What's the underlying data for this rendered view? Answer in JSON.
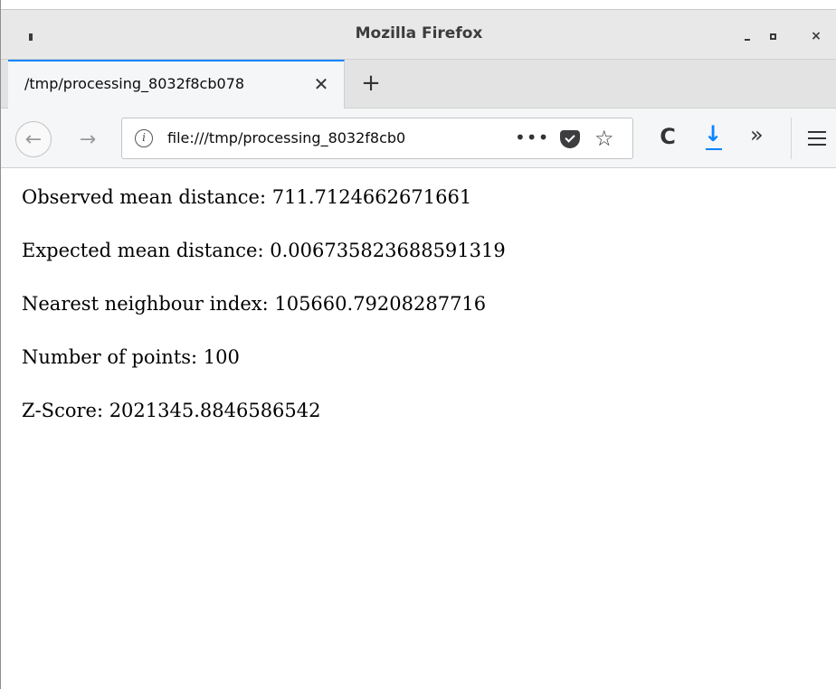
{
  "window": {
    "title": "Mozilla Firefox",
    "menu_icon": "window-menu-icon",
    "controls": {
      "minimize": "minimize-icon",
      "maximize": "maximize-icon",
      "close": "×"
    }
  },
  "tabs": [
    {
      "title": "/tmp/processing_8032f8cb078",
      "close": "✕",
      "active": true
    }
  ],
  "newtab_label": "+",
  "nav": {
    "back": "←",
    "forward": "→",
    "url": "file:///tmp/processing_8032f8cb0",
    "info": "i",
    "page_actions": "•••",
    "star": "☆",
    "reload": "C",
    "download": "↓",
    "overflow": "»"
  },
  "content": {
    "lines": [
      "Observed mean distance: 711.7124662671661",
      "Expected mean distance: 0.006735823688591319",
      "Nearest neighbour index: 105660.79208287716",
      "Number of points: 100",
      "Z-Score: 2021345.8846586542"
    ]
  },
  "colors": {
    "accent": "#0a84ff",
    "titlebar": "#e8e8e8",
    "toolbar": "#f5f6f7"
  }
}
